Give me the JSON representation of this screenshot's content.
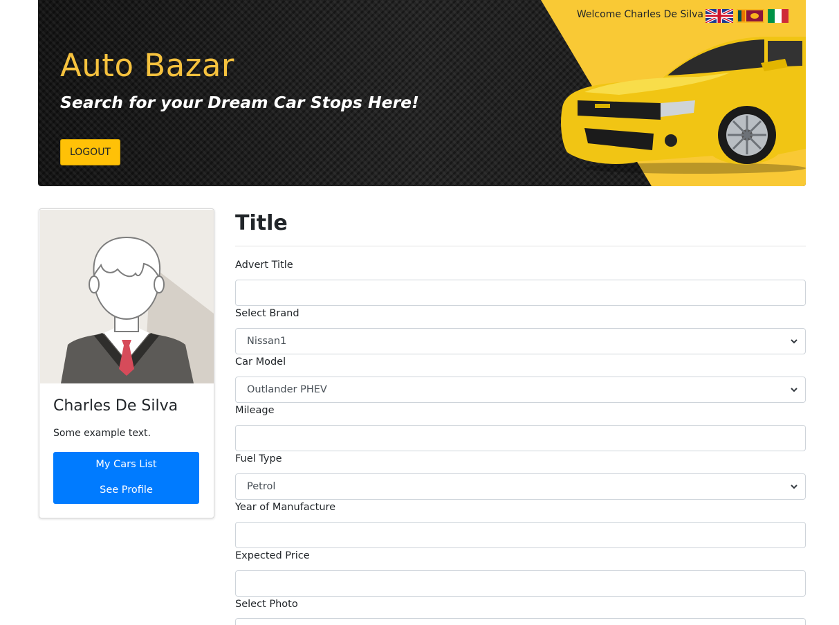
{
  "header": {
    "title": "Auto Bazar",
    "tagline": "Search for your Dream Car Stops Here!",
    "logout_label": "LOGOUT",
    "welcome_text": "Welcome Charles De Silva",
    "accent_color": "#f6c23e",
    "languages": [
      "english-flag",
      "sri-lanka-flag",
      "italian-flag"
    ]
  },
  "profile": {
    "name": "Charles De Silva",
    "description": "Some example text.",
    "links": [
      "My Cars List",
      "See Profile"
    ],
    "link_color": "#007bff"
  },
  "form": {
    "title": "Title",
    "fields": [
      {
        "label": "Advert Title",
        "type": "text",
        "value": ""
      },
      {
        "label": "Select Brand",
        "type": "select",
        "value": "Nissan1"
      },
      {
        "label": "Car Model",
        "type": "select",
        "value": "Outlander PHEV"
      },
      {
        "label": "Mileage",
        "type": "text",
        "value": ""
      },
      {
        "label": "Fuel Type",
        "type": "select",
        "value": "Petrol"
      },
      {
        "label": "Year of Manufacture",
        "type": "text",
        "value": ""
      },
      {
        "label": "Expected Price",
        "type": "text",
        "value": ""
      },
      {
        "label": "Select Photo",
        "type": "file",
        "value": ""
      }
    ]
  }
}
